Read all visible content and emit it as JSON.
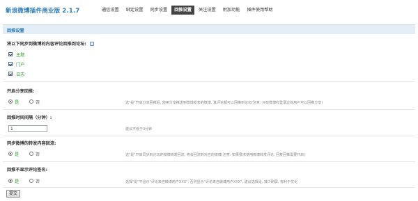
{
  "app": {
    "title": "新浪微博插件商业版",
    "version": "2.1.7"
  },
  "nav": {
    "tabs": [
      {
        "label": "通信设置",
        "active": false
      },
      {
        "label": "绑定设置",
        "active": false
      },
      {
        "label": "同步设置",
        "active": false
      },
      {
        "label": "回推设置",
        "active": true
      },
      {
        "label": "关注设置",
        "active": false
      },
      {
        "label": "附加功能",
        "active": false
      },
      {
        "label": "插件使用帮助",
        "active": false
      }
    ]
  },
  "section": {
    "title": "回推设置"
  },
  "q1": {
    "label": "将以下同步到微博的内容评论回推到论坛:",
    "options": [
      "主题",
      "门户",
      "日志"
    ]
  },
  "q2": {
    "label": "开启分享回推:",
    "yes": "是",
    "no": "否",
    "selected": "yes",
    "note": "选\"是\"开启分享回推后, 使用分享推送到微博发表的微博, 其评论都可以回推到论坛(注意: 只有微博有登录过的用户可以回推分享)"
  },
  "q3": {
    "label": "回推时间间隔（分钟）:",
    "value": "1",
    "note": "建议不低于3分钟"
  },
  "q4": {
    "label": "同步微博的转发内容回流:",
    "yes": "是",
    "no": "否",
    "selected": "yes",
    "note": "选\"是\"开启同步到论坛的微博转发回流, 将会回流到对应的微博(注意: 如果要求使用微博转发评论, 回复回推需要开启)"
  },
  "q5": {
    "label": "回推不显示评论签名:",
    "yes": "是",
    "no": "否",
    "selected": "yes",
    "note": "选择\"是\"不显示\"评论来自微博用户XXX\", 否则显示\"评论来自微博用户XXX\", 建议选择是, 减少刷屏, 有利于优化"
  },
  "submit_label": "提交",
  "colors": {
    "accent": "#2b7bb9",
    "option_green": "#2e9c2e",
    "header_bg": "#e3eef7"
  }
}
